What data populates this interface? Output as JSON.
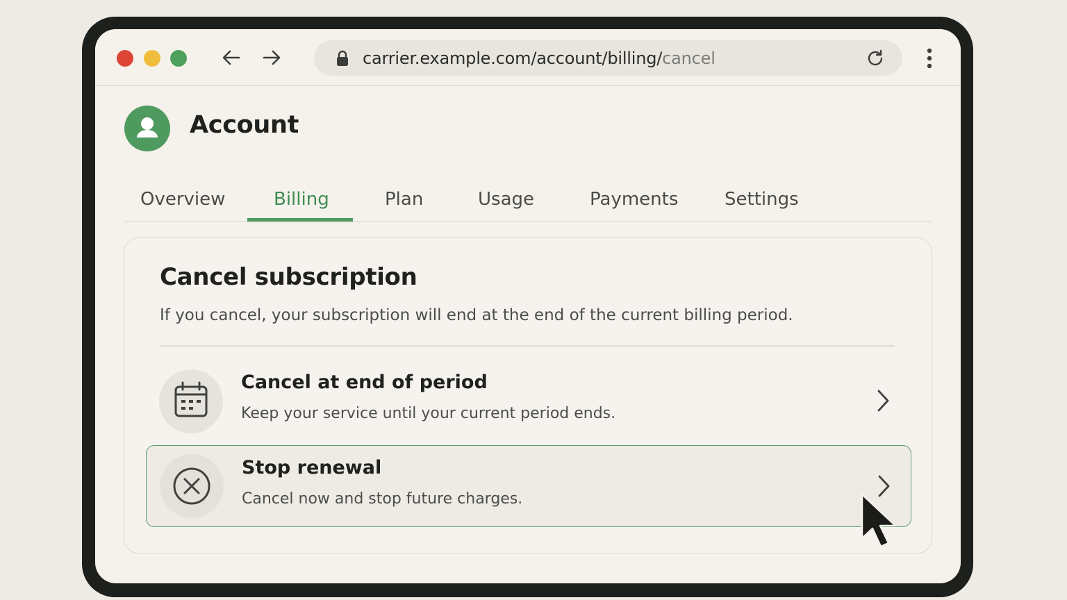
{
  "browser": {
    "url_main": "carrier.example.com/account/billing/",
    "url_dim": "cancel",
    "icons": {
      "back": "arrow-left-icon",
      "forward": "arrow-right-icon",
      "lock": "lock-icon",
      "reload": "reload-icon",
      "menu": "kebab-menu-icon"
    }
  },
  "header": {
    "title": "Account",
    "avatar_icon": "user-icon"
  },
  "tabs": [
    {
      "label": "Overview",
      "active": false
    },
    {
      "label": "Billing",
      "active": true
    },
    {
      "label": "Plan",
      "active": false
    },
    {
      "label": "Usage",
      "active": false
    },
    {
      "label": "Payments",
      "active": false
    },
    {
      "label": "Settings",
      "active": false
    }
  ],
  "card": {
    "title": "Cancel subscription",
    "description": "If you cancel, your subscription will end at the end of the current billing period.",
    "options": [
      {
        "title": "Cancel at end of period",
        "subtitle": "Keep your service until your current period ends.",
        "icon": "calendar-icon",
        "highlighted": false
      },
      {
        "title": "Stop renewal",
        "subtitle": "Cancel now and stop future charges.",
        "icon": "close-circle-icon",
        "highlighted": true
      }
    ]
  },
  "colors": {
    "accent": "#4f9a5f",
    "traffic_red": "#dd4637",
    "traffic_yellow": "#efbd3b",
    "traffic_green": "#4fa05c",
    "background": "#f5f2ec"
  }
}
